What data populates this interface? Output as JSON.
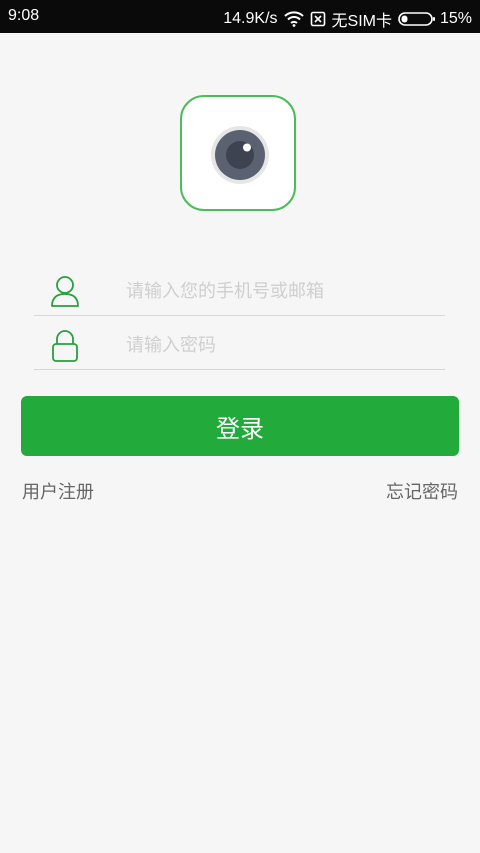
{
  "status_bar": {
    "time": "9:08",
    "network_speed": "14.9K/s",
    "sim_status": "无SIM卡",
    "battery_percent": "15%",
    "icons": [
      "wifi-icon",
      "no-sim-icon",
      "battery-icon"
    ]
  },
  "app": {
    "logo_icon": "camera-lens-icon",
    "accent_color": "#22aa3a",
    "logo_border_color": "#4cbc5a"
  },
  "form": {
    "account": {
      "placeholder": "请输入您的手机号或邮箱",
      "value": "",
      "icon": "user-icon"
    },
    "password": {
      "placeholder": "请输入密码",
      "value": "",
      "icon": "lock-icon"
    },
    "login_label": "登录"
  },
  "links": {
    "register": "用户注册",
    "forgot_password": "忘记密码"
  }
}
